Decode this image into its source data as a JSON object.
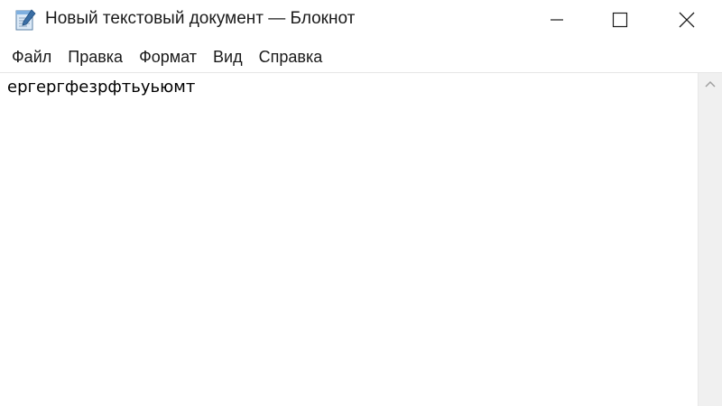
{
  "window": {
    "title": "Новый текстовый документ — Блокнот"
  },
  "icons": {
    "app": "notepad-icon",
    "minimize": "minimize-icon",
    "maximize": "maximize-icon",
    "close": "close-icon",
    "scroll_up": "chevron-up-icon"
  },
  "menu": {
    "items": [
      {
        "label": "Файл"
      },
      {
        "label": "Правка"
      },
      {
        "label": "Формат"
      },
      {
        "label": "Вид"
      },
      {
        "label": "Справка"
      }
    ]
  },
  "editor": {
    "content": "ергергфезрфтьуьюмт"
  },
  "colors": {
    "background": "#ffffff",
    "text": "#000000",
    "scrollbar": "#f0f0f0"
  }
}
